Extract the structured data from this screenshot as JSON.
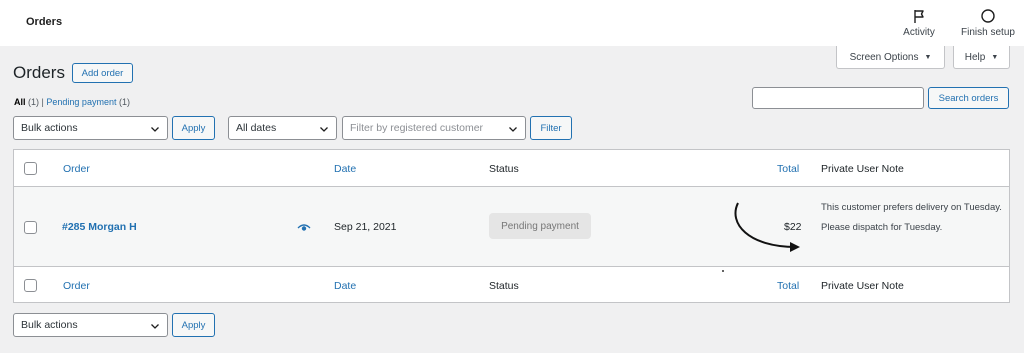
{
  "topbar": {
    "title": "Orders",
    "activity_label": "Activity",
    "finish_setup_label": "Finish setup"
  },
  "screen_options_label": "Screen Options",
  "help_label": "Help",
  "heading": "Orders",
  "add_order_label": "Add order",
  "views": {
    "all_label": "All",
    "all_count": "(1)",
    "separator": "|",
    "pending_label": "Pending payment",
    "pending_count": "(1)"
  },
  "search": {
    "value": "",
    "button_label": "Search orders"
  },
  "filters": {
    "bulk_actions": "Bulk actions",
    "apply_label": "Apply",
    "dates": "All dates",
    "customer_placeholder": "Filter by registered customer",
    "filter_label": "Filter"
  },
  "table": {
    "columns": {
      "order": "Order",
      "date": "Date",
      "status": "Status",
      "total": "Total",
      "note": "Private User Note"
    },
    "rows": [
      {
        "order": "#285 Morgan H",
        "date": "Sep 21, 2021",
        "status": "Pending payment",
        "total": "$22",
        "note": "This customer prefers delivery on Tuesday. Please dispatch for Tuesday."
      }
    ]
  },
  "bottom": {
    "bulk_actions": "Bulk actions",
    "apply_label": "Apply"
  },
  "icons": {
    "activity": "flag-icon",
    "finish_setup": "circle-icon",
    "preview": "eye-icon"
  },
  "colors": {
    "accent": "#2271b1",
    "status_pending_bg": "#e5e5e5",
    "background": "#f0f0f1"
  }
}
